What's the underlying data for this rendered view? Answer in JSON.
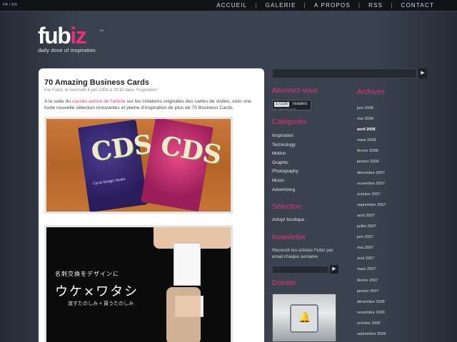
{
  "topbar": {
    "lang": "FR / EN",
    "nav": [
      "ACCUEIL",
      "GALERIE",
      "A PROPOS",
      "RSS",
      "CONTACT"
    ],
    "separator": "|"
  },
  "logo": {
    "word_start": "fub",
    "word_hi": "iz",
    "tm": "TM",
    "tagline": "daily dose of inspiration",
    "accent": "#e6327a"
  },
  "post": {
    "title": "70 Amazing Business Cards",
    "meta": "Par Fubiz, le mercredi 4 juin 2008 à 19:10 dans \"Inspiration\"",
    "body_before": "A la suite du ",
    "body_link": "succès autour de l'article",
    "body_after": " sur les créations originales des cartes de visites, voici une toute nouvelle sélection innovantes et pleine d'inspiration de plus de 70 Business Cards.",
    "image1": {
      "card1_letters": "CDS",
      "card1_text": "Cyrus Design Studio",
      "card2_letters": "CDS"
    },
    "image2": {
      "jp_line1": "名刺交換をデザインに",
      "jp_line2": "ウケ×ワタシ",
      "jp_line3": "渡すたのしみ × 貰うたのしみ"
    }
  },
  "sidebar": {
    "search_go": "▶",
    "abonnez": {
      "heading": "Abonnez-vous",
      "feed_count": "17226",
      "feed_label": "readers",
      "feed_by": "BY FEEDBURNER"
    },
    "categories": {
      "heading": "Catégories",
      "items": [
        "Inspiration",
        "Technology",
        "Motion",
        "Graphic",
        "Photography",
        "Music",
        "Advertising"
      ]
    },
    "selection": {
      "heading": "Sélection",
      "items": [
        "Artoyz boutique"
      ]
    },
    "newsletter": {
      "heading": "Newsletter",
      "text": "Recevoir les articles Fubiz par email chaque semaine",
      "go": "▶"
    },
    "dossier": {
      "heading": "Dossier"
    },
    "archives": {
      "heading": "Archives",
      "items": [
        "juin 2008",
        "mai 2008",
        "avril 2008",
        "mars 2008",
        "février 2008",
        "janvier 2008",
        "décembre 2007",
        "novembre 2007",
        "octobre 2007",
        "septembre 2007",
        "août 2007",
        "juillet 2007",
        "juin 2007",
        "mai 2007",
        "avril 2007",
        "mars 2007",
        "février 2007",
        "janvier 2007",
        "décembre 2006",
        "novembre 2006",
        "octobre 2006",
        "septembre 2006"
      ],
      "current": "avril 2008"
    }
  }
}
